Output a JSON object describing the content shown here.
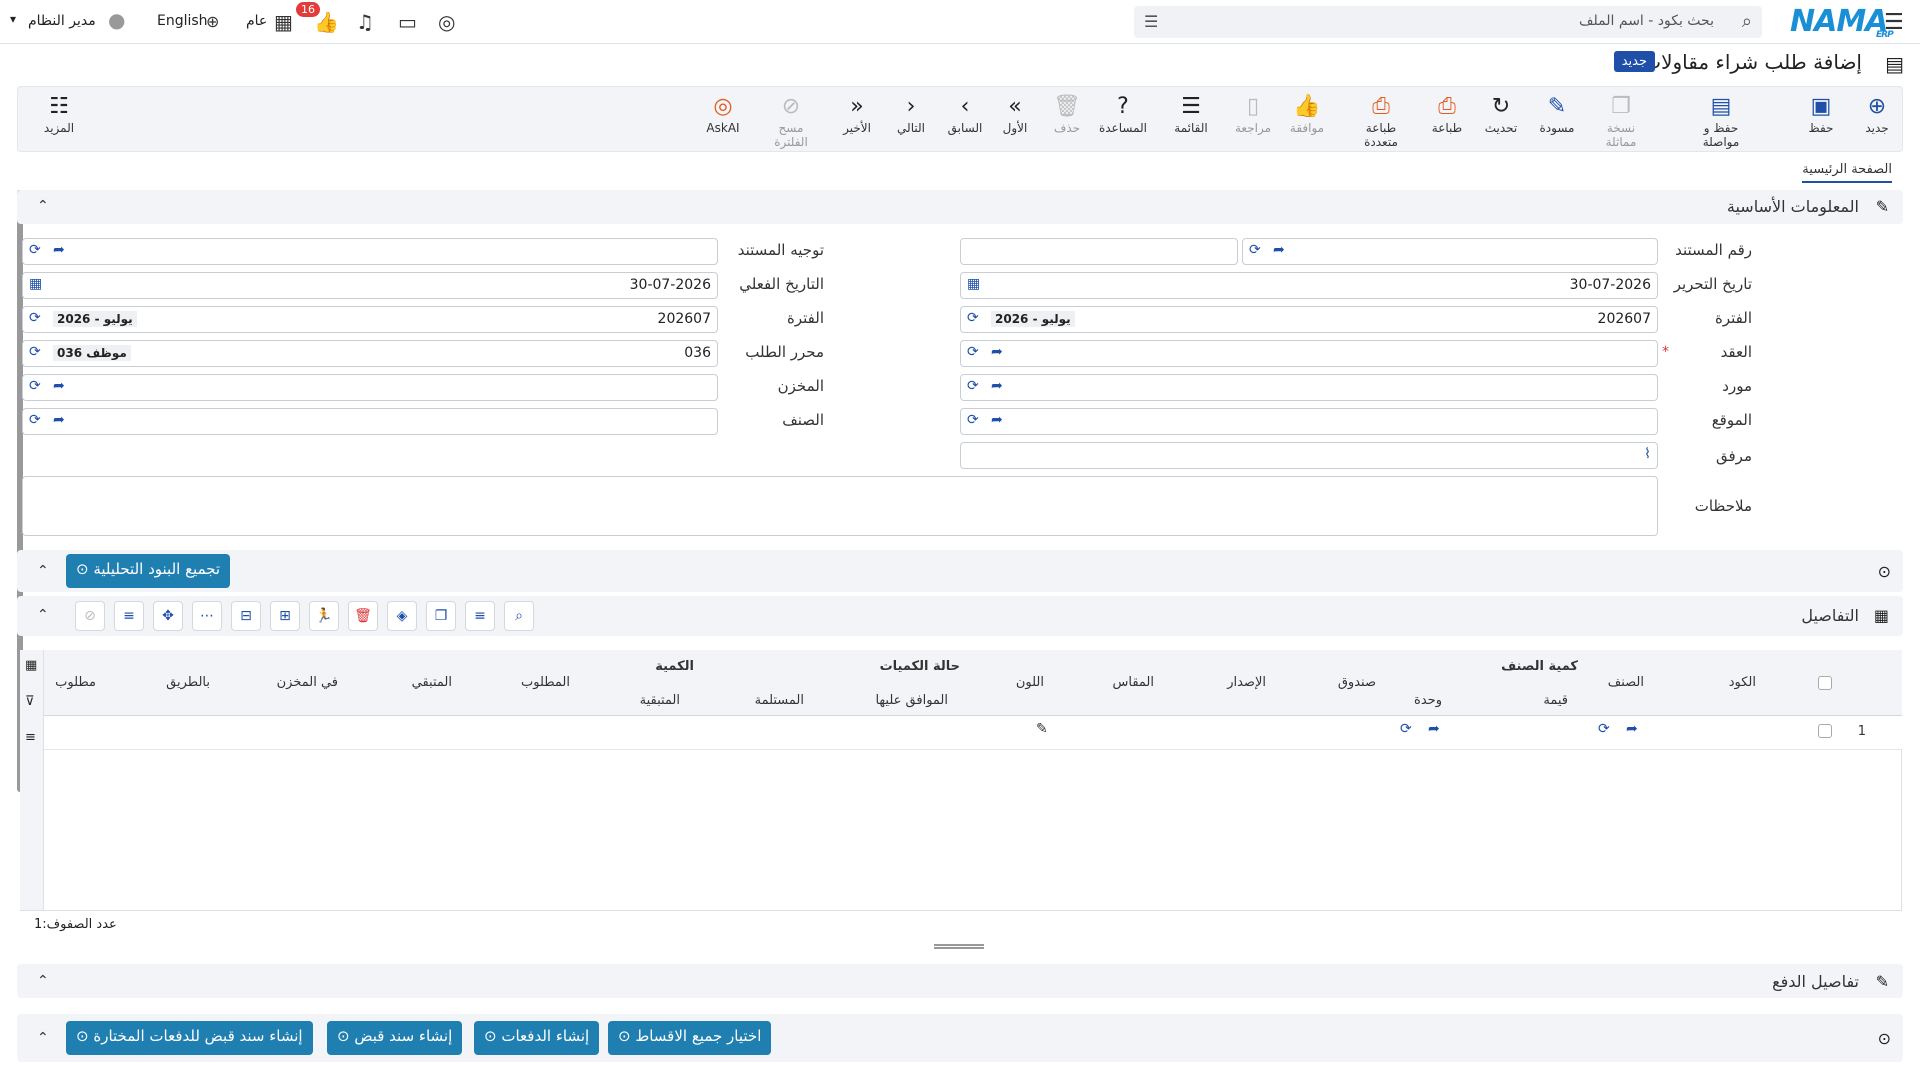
{
  "topbar": {
    "search_placeholder": "بحث بكود - اسم الملف",
    "logo": "NAMA",
    "logo_sub": "ERP",
    "user": "مدير النظام",
    "language": "English",
    "scope": "عام",
    "notif_count": "16"
  },
  "page": {
    "title": "إضافة طلب شراء مقاولات",
    "status": "جديد",
    "tab_main": "الصفحة الرئيسية"
  },
  "toolbar": [
    {
      "label": "جديد",
      "icon": "plus-circle-icon"
    },
    {
      "label": "حفظ",
      "icon": "save-icon"
    },
    {
      "label": "حفظ و مواصلة",
      "icon": "save-continue-icon"
    },
    {
      "label": "نسخة مماثلة",
      "icon": "copy-icon"
    },
    {
      "label": "مسودة",
      "icon": "draft-icon"
    },
    {
      "label": "تحديث",
      "icon": "refresh-icon"
    },
    {
      "label": "طباعة",
      "icon": "print-icon"
    },
    {
      "label": "طباعة متعددة",
      "icon": "multi-print-icon"
    },
    {
      "label": "موافقة",
      "icon": "approve-icon"
    },
    {
      "label": "مراجعة",
      "icon": "review-icon"
    },
    {
      "label": "القائمة",
      "icon": "list-icon"
    },
    {
      "label": "المساعدة",
      "icon": "help-icon"
    },
    {
      "label": "حذف",
      "icon": "delete-icon"
    },
    {
      "label": "الأول",
      "icon": "first-icon"
    },
    {
      "label": "السابق",
      "icon": "prev-icon"
    },
    {
      "label": "التالي",
      "icon": "next-icon"
    },
    {
      "label": "الأخير",
      "icon": "last-icon"
    },
    {
      "label": "مسح الفلترة",
      "icon": "clear-filter-icon"
    },
    {
      "label": "AskAI",
      "icon": "ai-icon"
    }
  ],
  "more_label": "المزيد",
  "basic": {
    "title": "المعلومات الأساسية",
    "doc_no": "رقم المستند",
    "doc_route": "توجيه المستند",
    "edit_date": "تاريخ التحرير",
    "edit_date_val": "30-07-2026",
    "actual_date": "التاريخ الفعلي",
    "actual_date_val": "30-07-2026",
    "period": "الفترة",
    "period_val": "202607",
    "period_tag": "2026 - يوليو",
    "contract": "العقد",
    "requester": "محرر الطلب",
    "requester_val": "036",
    "requester_tag": "موظف 036",
    "supplier": "مورد",
    "warehouse": "المخزن",
    "location": "الموقع",
    "item": "الصنف",
    "attachment": "مرفق",
    "notes": "ملاحظات"
  },
  "aggregate_btn": "تجميع البنود التحليلية",
  "details": {
    "title": "التفاصيل",
    "row_count_label": "عدد الصفوف:",
    "row_count": "1",
    "cols": {
      "code": "الكود",
      "item": "الصنف",
      "item_qty": "كمية الصنف",
      "unit": "وحدة",
      "value": "قيمة",
      "box": "صندوق",
      "version": "الإصدار",
      "size": "المقاس",
      "color": "اللون",
      "qty_status": "حالة الكميات",
      "approved": "الموافق عليها",
      "received": "المستلمة",
      "qty": "الكمية",
      "remaining_q": "المتبقية",
      "required": "المطلوب",
      "remaining": "المتبقي",
      "in_stock": "في المخزن",
      "on_way": "بالطريق",
      "needed": "مطلوب"
    },
    "row_no": "1"
  },
  "payment": {
    "title": "تفاصيل الدفع",
    "btn_select_all": "اختيار جميع الاقساط",
    "btn_create_payments": "إنشاء الدفعات",
    "btn_receipt": "إنشاء سند قبض",
    "btn_receipt_selected": "إنشاء سند قبض للدفعات المختارة"
  }
}
